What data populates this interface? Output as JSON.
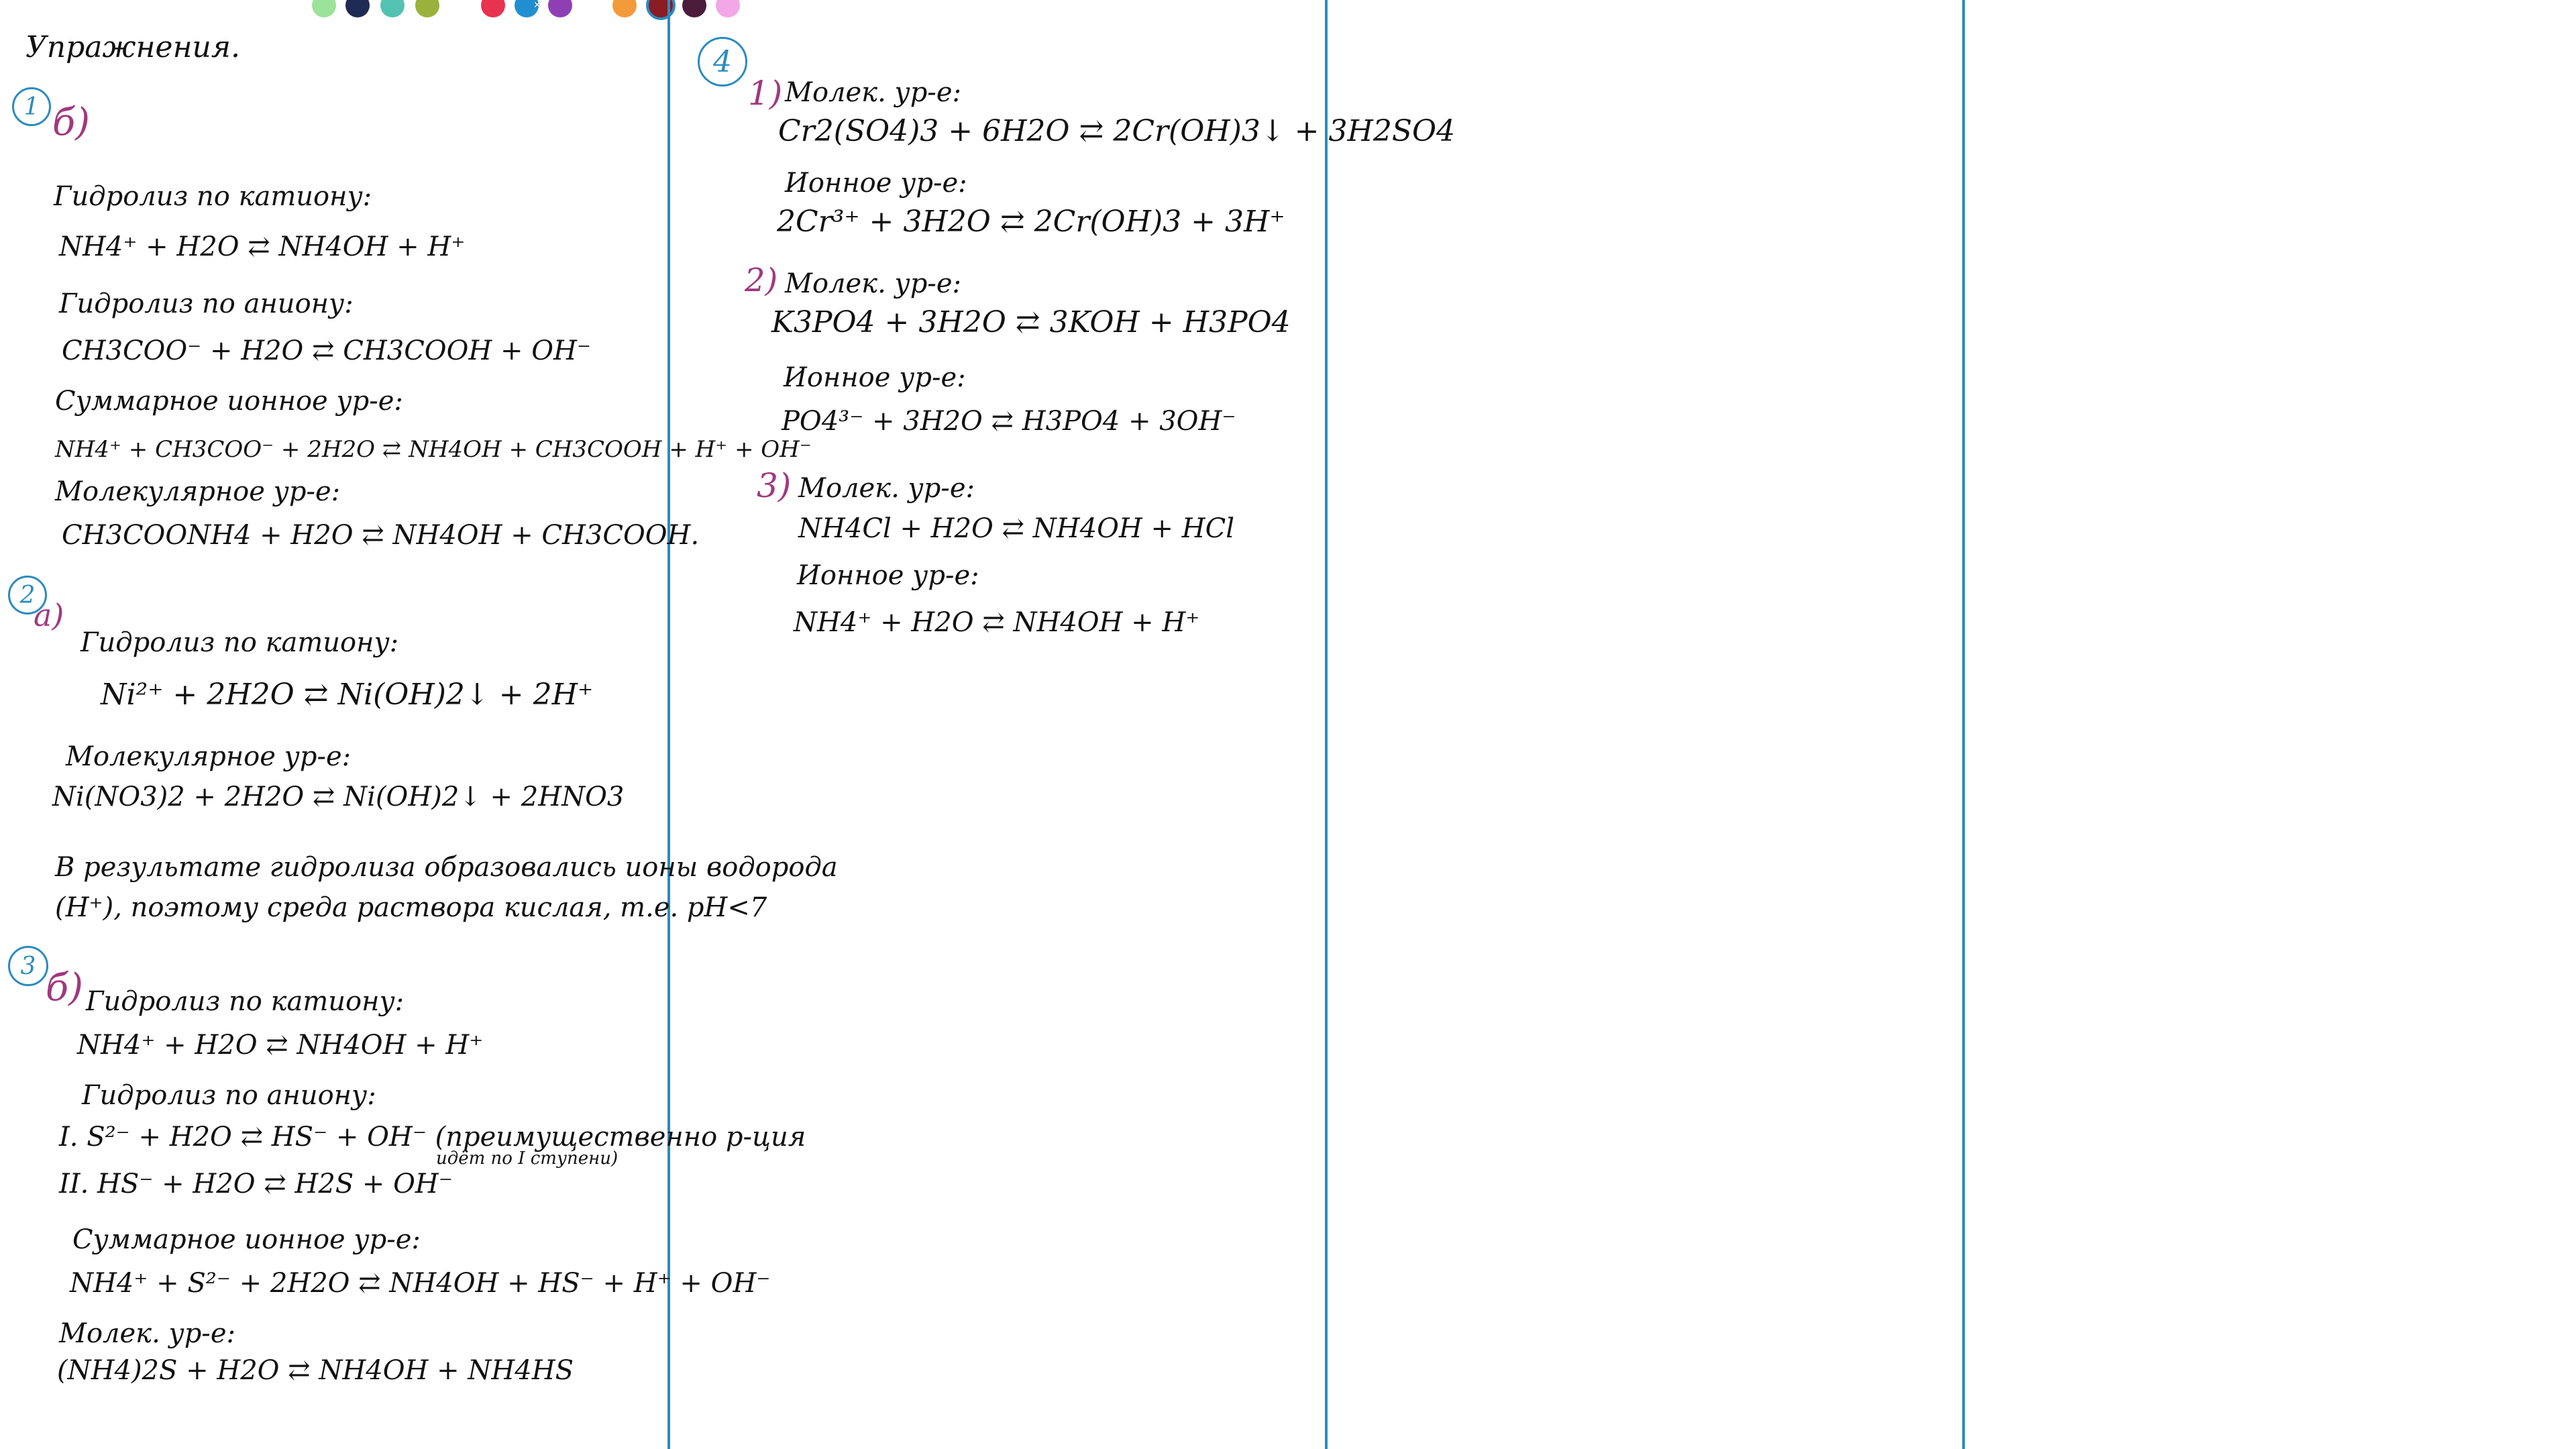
{
  "palette": [
    {
      "name": "light-green",
      "color": "#9be39b"
    },
    {
      "name": "navy",
      "color": "#1f2a55"
    },
    {
      "name": "teal",
      "color": "#54c2b3"
    },
    {
      "name": "olive",
      "color": "#9ab23b"
    },
    {
      "name": "red",
      "color": "#e8334f"
    },
    {
      "name": "blue",
      "color": "#1f8fd1"
    },
    {
      "name": "purple",
      "color": "#8e3fb4"
    },
    {
      "name": "orange",
      "color": "#f39a3a"
    },
    {
      "name": "dark-red",
      "color": "#8a1c24"
    },
    {
      "name": "plum",
      "color": "#4b1c3c"
    },
    {
      "name": "pink",
      "color": "#f2a7e6"
    }
  ],
  "colors": {
    "divider": "#2b8bc0",
    "label": "#a0397f",
    "coef": "#e0304a"
  },
  "col1": {
    "title": "Упражнения.",
    "t1": {
      "num": "1",
      "label": "б)",
      "l1": "Гидролиз по катиону:",
      "l2": "NH4⁺ + H2O ⇄ NH4OH + H⁺",
      "l3": "Гидролиз по аниону:",
      "l4": "CH3COO⁻ + H2O ⇄ CH3COOH + OH⁻",
      "l5": "Суммарное ионное ур-е:",
      "l6": "NH4⁺ + CH3COO⁻ + 2H2O ⇄ NH4OH + CH3COOH + H⁺ + OH⁻",
      "l7": "Молекулярное ур-е:",
      "l8": "CH3COONH4 + H2O ⇄ NH4OH + CH3COOH."
    },
    "t2": {
      "num": "2",
      "label": "а)",
      "l1": "Гидролиз по катиону:",
      "l2": "Ni²⁺ + 2H2O ⇄ Ni(OH)2↓ + 2H⁺",
      "l3": "Молекулярное ур-е:",
      "l4": "Ni(NO3)2 + 2H2O ⇄ Ni(OH)2↓ + 2HNO3",
      "l5": "В результате гидролиза образовались ионы водорода",
      "l6": "(H⁺), поэтому среда раствора кислая, т.е. pH<7"
    },
    "t3": {
      "num": "3",
      "label": "б)",
      "l1": "Гидролиз по катиону:",
      "l2": "NH4⁺ + H2O ⇄ NH4OH + H⁺",
      "l3": "Гидролиз по аниону:",
      "l4": "I. S²⁻ + H2O ⇄ HS⁻ + OH⁻ (преимущественно р-ция",
      "l4b": "идёт по I ступени)",
      "l5": "II. HS⁻ + H2O ⇄ H2S + OH⁻",
      "l6": "Суммарное ионное ур-е:",
      "l7": "NH4⁺ + S²⁻ + 2H2O ⇄ NH4OH + HS⁻ + H⁺ + OH⁻",
      "l8": "Молек. ур-е:",
      "l9": "(NH4)2S + H2O ⇄ NH4OH + NH4HS"
    }
  },
  "col2": {
    "t4": {
      "num": "4",
      "p1": {
        "label": "1)",
        "l1": "Молек. ур-е:",
        "l2": "Cr2(SO4)3 + 6H2O ⇄ 2Cr(OH)3↓ + 3H2SO4",
        "l3": "Ионное ур-е:",
        "l4": "2Cr³⁺ + 3H2O ⇄ 2Cr(OH)3 + 3H⁺"
      },
      "p2": {
        "label": "2)",
        "l1": "Молек. ур-е:",
        "l2": "K3PO4 + 3H2O ⇄ 3KOH + H3PO4",
        "l3": "Ионное ур-е:",
        "l4": "PO4³⁻ + 3H2O ⇄ H3PO4 + 3OH⁻"
      },
      "p3": {
        "label": "3)",
        "l1": "Молек. ур-е:",
        "l2": "NH4Cl + H2O ⇄ NH4OH + HCl",
        "l3": "Ионное ур-е:",
        "l4": "NH4⁺ + H2O ⇄ NH4OH + H⁺"
      }
    }
  }
}
